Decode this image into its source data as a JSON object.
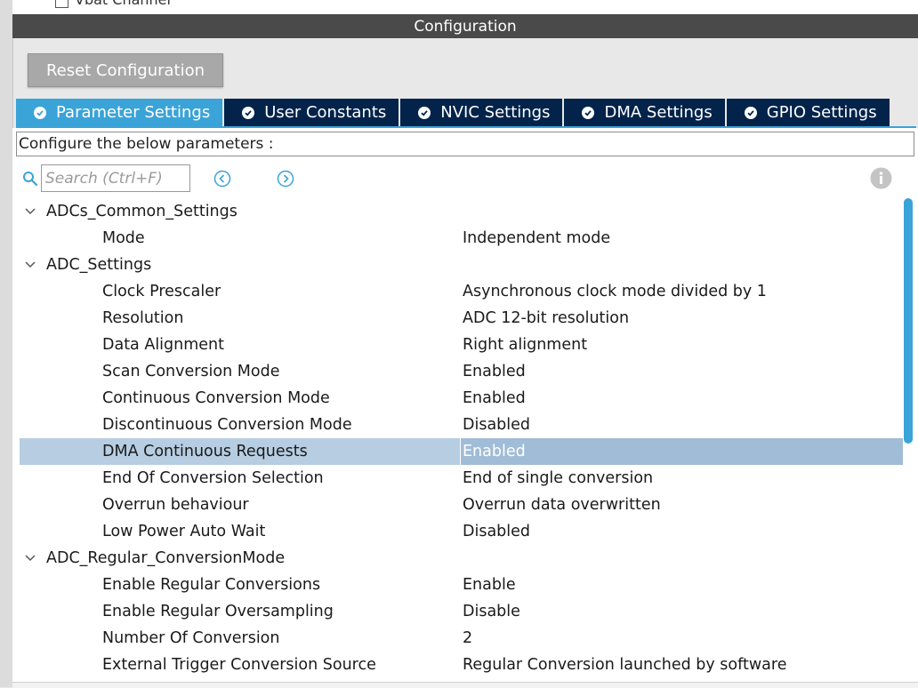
{
  "top_strip": {
    "label": "Vbat Channel"
  },
  "header": {
    "title": "Configuration"
  },
  "reset_button": {
    "label": "Reset Configuration"
  },
  "tabs": [
    {
      "label": "Parameter Settings",
      "active": true
    },
    {
      "label": "User Constants",
      "active": false
    },
    {
      "label": "NVIC Settings",
      "active": false
    },
    {
      "label": "DMA Settings",
      "active": false
    },
    {
      "label": "GPIO Settings",
      "active": false
    }
  ],
  "describe_label": "Configure the below parameters :",
  "search": {
    "placeholder": "Search (Ctrl+F)",
    "value": ""
  },
  "icons": {
    "search": "search-icon",
    "prev": "circle-chevron-left-icon",
    "next": "circle-chevron-right-icon",
    "info": "info-icon",
    "expand": "chevron-down-icon",
    "tab_check": "check-circle-icon"
  },
  "colors": {
    "accent": "#3aa3d8",
    "tab_bg": "#03234b",
    "header_bg": "#4a4a4a",
    "selected_row": "#b7cde2"
  },
  "tree": {
    "groups": [
      {
        "name": "ADCs_Common_Settings",
        "params": [
          {
            "name": "Mode",
            "value": "Independent mode"
          }
        ]
      },
      {
        "name": "ADC_Settings",
        "params": [
          {
            "name": "Clock Prescaler",
            "value": "Asynchronous clock mode divided by 1"
          },
          {
            "name": "Resolution",
            "value": "ADC 12-bit resolution"
          },
          {
            "name": "Data Alignment",
            "value": "Right alignment"
          },
          {
            "name": "Scan Conversion Mode",
            "value": "Enabled"
          },
          {
            "name": "Continuous Conversion Mode",
            "value": "Enabled"
          },
          {
            "name": "Discontinuous Conversion Mode",
            "value": "Disabled"
          },
          {
            "name": "DMA Continuous Requests",
            "value": "Enabled",
            "selected": true
          },
          {
            "name": "End Of Conversion Selection",
            "value": "End of single conversion"
          },
          {
            "name": "Overrun behaviour",
            "value": "Overrun data overwritten"
          },
          {
            "name": "Low Power Auto Wait",
            "value": "Disabled"
          }
        ]
      },
      {
        "name": "ADC_Regular_ConversionMode",
        "params": [
          {
            "name": "Enable Regular Conversions",
            "value": "Enable"
          },
          {
            "name": "Enable Regular Oversampling",
            "value": "Disable"
          },
          {
            "name": "Number Of Conversion",
            "value": "2"
          },
          {
            "name": "External Trigger Conversion Source",
            "value": "Regular Conversion launched by software"
          }
        ]
      }
    ]
  }
}
